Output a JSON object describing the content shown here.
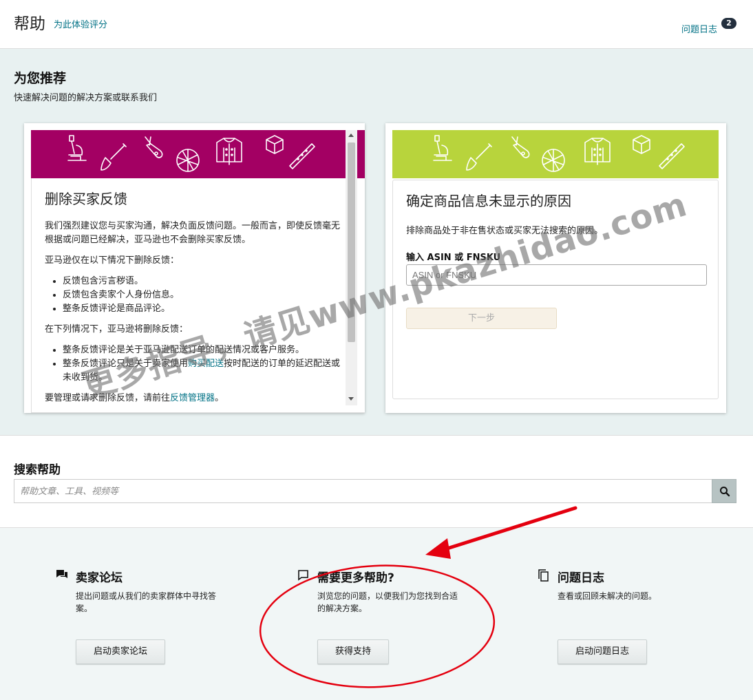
{
  "header": {
    "title": "帮助",
    "rate_link": "为此体验评分",
    "case_log_link": "问题日志",
    "case_log_count": "2"
  },
  "recommend": {
    "title": "为您推荐",
    "subtitle": "快速解决问题的解决方案或联系我们",
    "left_card": {
      "banner_color": "#a30063",
      "heading": "删除买家反馈",
      "p1": "我们强烈建议您与买家沟通，解决负面反馈问题。一般而言，即使反馈毫无根据或问题已经解决，亚马逊也不会删除买家反馈。",
      "p2": "亚马逊仅在以下情况下删除反馈：",
      "list1": [
        "反馈包含污言秽语。",
        "反馈包含卖家个人身份信息。",
        "整条反馈评论是商品评论。"
      ],
      "p3": "在下列情况下，亚马逊将删除反馈：",
      "list2_item1": "整条反馈评论是关于亚马逊配送订单的配送情况或客户服务。",
      "list2_item2_pre": "整条反馈评论只是关于卖家使用",
      "list2_item2_link": "购买配送",
      "list2_item2_post": "按时配送的订单的延迟配送或未收到货。",
      "p4_pre": "要管理或请求删除反馈，请前往",
      "p4_link": "反馈管理器",
      "p4_post": "。"
    },
    "right_card": {
      "banner_color": "#b8d43c",
      "heading": "确定商品信息未显示的原因",
      "desc": "排除商品处于非在售状态或买家无法搜索的原因。",
      "input_label": "输入 ASIN 或 FNSKU",
      "input_placeholder": "ASIN or FNSKU",
      "next_button": "下一步"
    }
  },
  "search": {
    "title": "搜索帮助",
    "placeholder": "帮助文章、工具、视频等"
  },
  "bottom": {
    "forum": {
      "icon": "chat-icon",
      "title": "卖家论坛",
      "desc": "提出问题或从我们的卖家群体中寻找答案。",
      "button": "启动卖家论坛"
    },
    "more_help": {
      "icon": "speech-bubble-icon",
      "title": "需要更多帮助?",
      "desc": "浏览您的问题，以便我们为您找到合适的解决方案。",
      "button": "获得支持"
    },
    "case_log": {
      "icon": "copy-icon",
      "title": "问题日志",
      "desc": "查看或回顾未解决的问题。",
      "button": "启动问题日志"
    }
  },
  "watermark": "更多指导，请见www.pkazhidao.com",
  "annotation_color": "#e4000f"
}
